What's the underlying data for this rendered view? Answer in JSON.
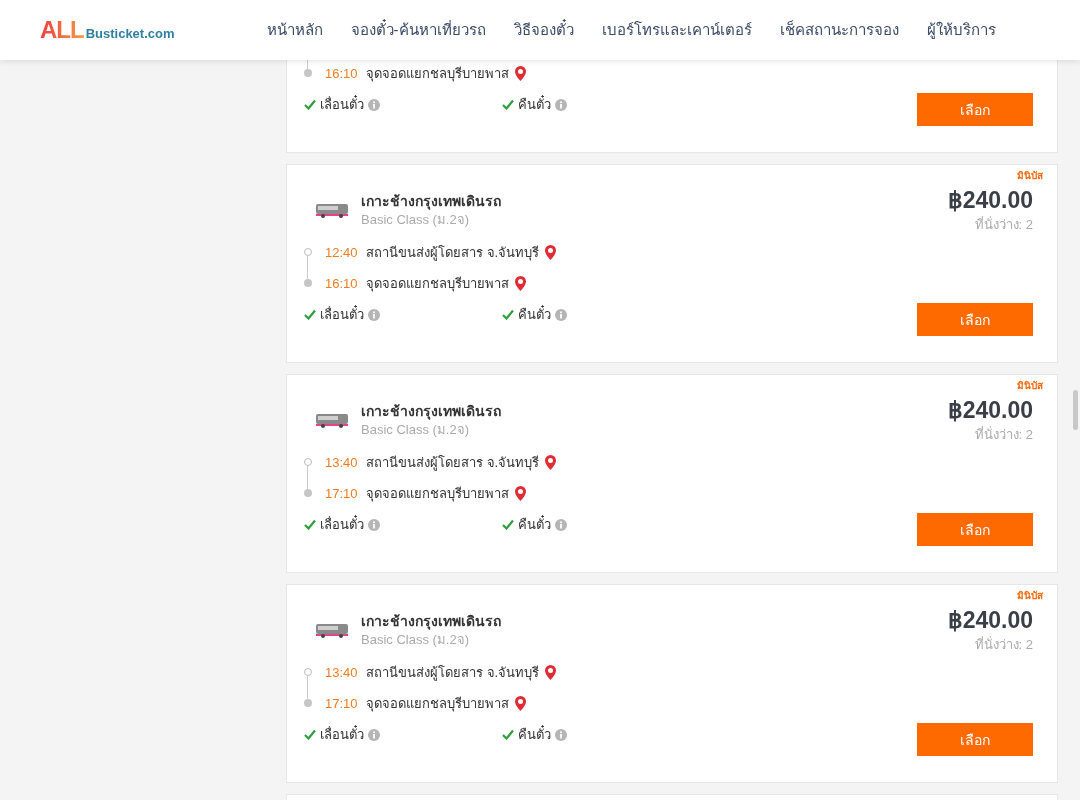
{
  "header": {
    "logo": {
      "main": "ALL",
      "suffix": "Busticket.com"
    },
    "nav": [
      {
        "label": "หน้าหลัก"
      },
      {
        "label": "จองตั๋ว-ค้นหาเที่ยวรถ"
      },
      {
        "label": "วิธีจองตั๋ว"
      },
      {
        "label": "เบอร์โทรและเคาน์เตอร์"
      },
      {
        "label": "เช็คสถานะการจอง"
      },
      {
        "label": "ผู้ให้บริการ"
      }
    ]
  },
  "results": [
    {
      "stops": [
        {
          "kind": "arrival",
          "time": "16:10",
          "place": "จุดจอดแยกชลบุรีบายพาส"
        }
      ],
      "features": [
        {
          "label": "เลื่อนตั๋ว",
          "checked": true
        },
        {
          "label": "คืนตั๋ว",
          "checked": true
        }
      ],
      "button": "เลือก"
    },
    {
      "tag": "มินิบัส",
      "operator": "เกาะช้างกรุงเทพเดินรถ",
      "class": "Basic Class (ม.2จ)",
      "price": "฿240.00",
      "seats": "ที่นั่งว่าง: 2",
      "stops": [
        {
          "kind": "departure",
          "time": "12:40",
          "place": "สถานีขนส่งผู้โดยสาร จ.จันทบุรี"
        },
        {
          "kind": "arrival",
          "time": "16:10",
          "place": "จุดจอดแยกชลบุรีบายพาส"
        }
      ],
      "features": [
        {
          "label": "เลื่อนตั๋ว",
          "checked": true
        },
        {
          "label": "คืนตั๋ว",
          "checked": true
        }
      ],
      "button": "เลือก"
    },
    {
      "tag": "มินิบัส",
      "operator": "เกาะช้างกรุงเทพเดินรถ",
      "class": "Basic Class (ม.2จ)",
      "price": "฿240.00",
      "seats": "ที่นั่งว่าง: 2",
      "stops": [
        {
          "kind": "departure",
          "time": "13:40",
          "place": "สถานีขนส่งผู้โดยสาร จ.จันทบุรี"
        },
        {
          "kind": "arrival",
          "time": "17:10",
          "place": "จุดจอดแยกชลบุรีบายพาส"
        }
      ],
      "features": [
        {
          "label": "เลื่อนตั๋ว",
          "checked": true
        },
        {
          "label": "คืนตั๋ว",
          "checked": true
        }
      ],
      "button": "เลือก"
    },
    {
      "tag": "มินิบัส",
      "operator": "เกาะช้างกรุงเทพเดินรถ",
      "class": "Basic Class (ม.2จ)",
      "price": "฿240.00",
      "seats": "ที่นั่งว่าง: 2",
      "stops": [
        {
          "kind": "departure",
          "time": "13:40",
          "place": "สถานีขนส่งผู้โดยสาร จ.จันทบุรี"
        },
        {
          "kind": "arrival",
          "time": "17:10",
          "place": "จุดจอดแยกชลบุรีบายพาส"
        }
      ],
      "features": [
        {
          "label": "เลื่อนตั๋ว",
          "checked": true
        },
        {
          "label": "คืนตั๋ว",
          "checked": true
        }
      ],
      "button": "เลือก"
    }
  ],
  "more_results_below": true
}
